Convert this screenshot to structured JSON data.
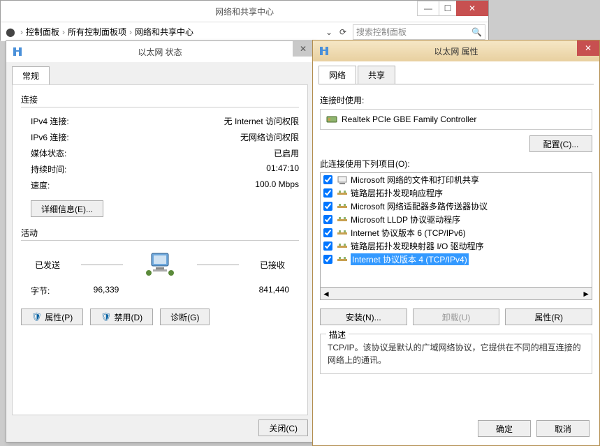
{
  "mainWindow": {
    "title": "网络和共享中心",
    "breadcrumbs": [
      "控制面板",
      "所有控制面板项",
      "网络和共享中心"
    ],
    "searchPlaceholder": "搜索控制面板"
  },
  "statusDialog": {
    "title": "以太网 状态",
    "tab": "常规",
    "connGroup": "连接",
    "rows": {
      "ipv4_k": "IPv4 连接:",
      "ipv4_v": "无 Internet 访问权限",
      "ipv6_k": "IPv6 连接:",
      "ipv6_v": "无网络访问权限",
      "media_k": "媒体状态:",
      "media_v": "已启用",
      "dur_k": "持续时间:",
      "dur_v": "01:47:10",
      "speed_k": "速度:",
      "speed_v": "100.0 Mbps"
    },
    "details_btn": "详细信息(E)...",
    "activityGroup": "活动",
    "sent": "已发送",
    "recv": "已接收",
    "bytes_k": "字节:",
    "bytes_sent": "96,339",
    "bytes_recv": "841,440",
    "prop_btn": "属性(P)",
    "disable_btn": "禁用(D)",
    "diag_btn": "诊断(G)",
    "close_btn": "关闭(C)"
  },
  "propDialog": {
    "title": "以太网 属性",
    "tabs": [
      "网络",
      "共享"
    ],
    "connUsing": "连接时使用:",
    "adapter": "Realtek PCIe GBE Family Controller",
    "configure_btn": "配置(C)...",
    "itemsLabel": "此连接使用下列项目(O):",
    "items": [
      {
        "label": "Microsoft 网络的文件和打印机共享",
        "icon": "svc"
      },
      {
        "label": "链路层拓扑发现响应程序",
        "icon": "proto"
      },
      {
        "label": "Microsoft 网络适配器多路传送器协议",
        "icon": "proto"
      },
      {
        "label": "Microsoft LLDP 协议驱动程序",
        "icon": "proto"
      },
      {
        "label": "Internet 协议版本 6 (TCP/IPv6)",
        "icon": "proto"
      },
      {
        "label": "链路层拓扑发现映射器 I/O 驱动程序",
        "icon": "proto"
      },
      {
        "label": "Internet 协议版本 4 (TCP/IPv4)",
        "icon": "proto",
        "selected": true
      }
    ],
    "install_btn": "安装(N)...",
    "uninstall_btn": "卸载(U)",
    "propitem_btn": "属性(R)",
    "descLegend": "描述",
    "descText": "TCP/IP。该协议是默认的广域网络协议，它提供在不同的相互连接的网络上的通讯。",
    "ok": "确定",
    "cancel": "取消"
  }
}
